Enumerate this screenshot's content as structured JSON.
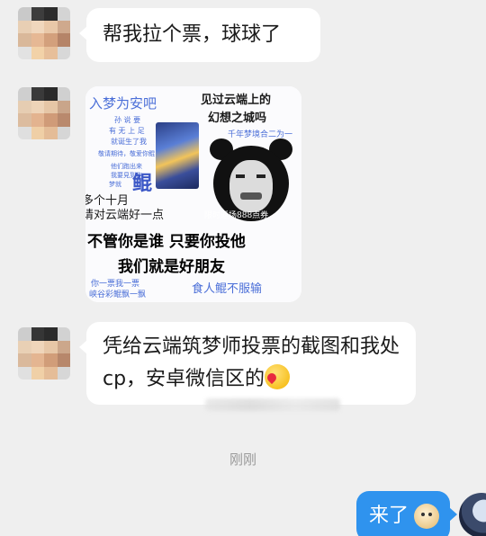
{
  "messages": [
    {
      "sender": "other",
      "type": "text",
      "text": "帮我拉个票，球球了"
    },
    {
      "sender": "other",
      "type": "sticker",
      "sticker": {
        "line1": "入梦为安吧",
        "line2": "见过云端上的",
        "line3": "幻想之城吗",
        "line4": "千年梦境合二为一",
        "line5": "鲲",
        "line6": "多个十月",
        "line7": "请对云端好一点",
        "line8": "限时返场888点券",
        "line9": "不管你是谁 只要你投他",
        "line10": "我们就是好朋友",
        "line11": "你一票我一票",
        "line12": "峡谷彩鲲飘一飘",
        "line13": "食人鲲不服输",
        "small1": "孙 说 要",
        "small2": "有 无 上 足",
        "small3": "就诞生了我",
        "small4": "敬请期待，敬爱你鲲",
        "small5": "他们跑出来",
        "small6": "我要見到你",
        "small7": "梦就"
      }
    },
    {
      "sender": "other",
      "type": "text",
      "text": "凭给云端筑梦师投票的截图和我处cp，安卓微信区的"
    },
    {
      "sender": "me",
      "type": "text",
      "text": "来了"
    }
  ],
  "timestamp": "刚刚",
  "colors": {
    "background": "#efefef",
    "bubble_other": "#ffffff",
    "bubble_me": "#2f93ee",
    "timestamp": "#9a9a9a"
  }
}
